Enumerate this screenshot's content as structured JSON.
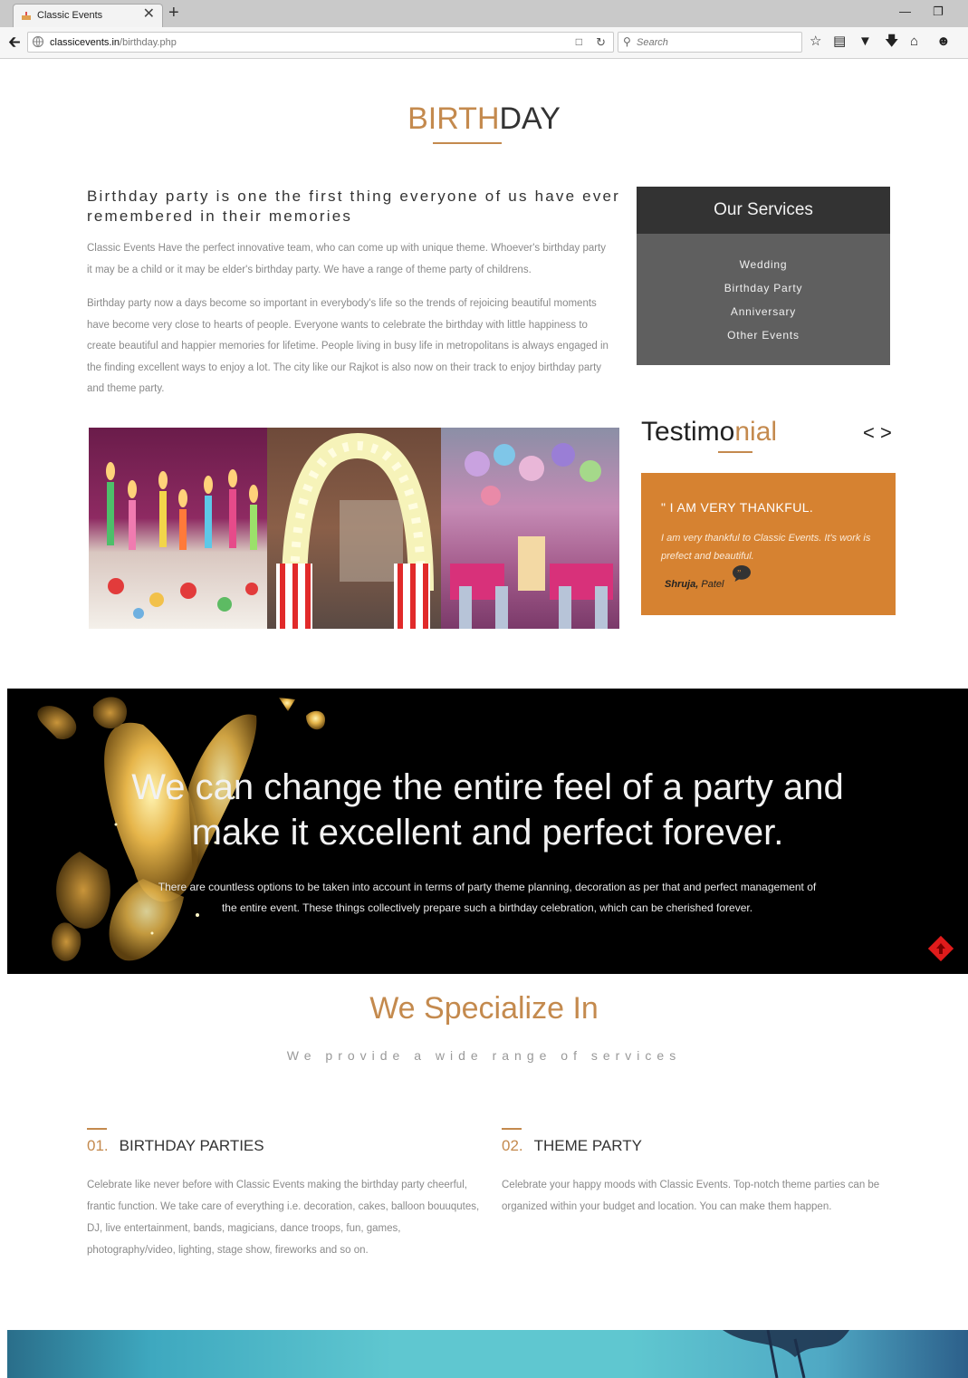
{
  "browser": {
    "tab_title": "Classic Events",
    "tab_close": "✕",
    "new_tab": "+",
    "url_domain": "classicevents.in",
    "url_path": "/birthday.php",
    "search_placeholder": "Search"
  },
  "page": {
    "title_part1": "BIRTH",
    "title_part2": "DAY",
    "intro_heading": "Birthday party is one the first thing everyone of us have ever remembered in their memories",
    "intro_p1": "Classic Events Have the perfect innovative team, who can come up with unique theme. Whoever's birthday party it may be a child or it may be elder's birthday party. We have a range of theme party of childrens.",
    "intro_p2": "Birthday party now a days become so important in everybody's life so the trends of rejoicing beautiful moments have become very close to hearts of people. Everyone wants to celebrate the birthday with little happiness to create beautiful and happier memories for lifetime. People living in busy life in metropolitans is always engaged in the finding excellent ways to enjoy a lot. The city like our Rajkot is also now on their track to enjoy birthday party and theme party."
  },
  "services": {
    "heading": "Our Services",
    "items": [
      "Wedding",
      "Birthday Party",
      "Anniversary",
      "Other Events"
    ]
  },
  "testimonial": {
    "title_part1": "Testimo",
    "title_part2": "nial",
    "prev": "<",
    "next": ">",
    "quote_heading": "\" I AM VERY THANKFUL.",
    "quote": "I am very thankful to Classic Events. It's work is prefect and beautiful.",
    "author_first": "Shruja,",
    "author_last": "Patel"
  },
  "banner": {
    "heading_line1": "We can change the entire feel of a party and",
    "heading_line2": "make it excellent and perfect forever.",
    "text": "There are countless options to be taken into account in terms of party theme planning, decoration as per that and perfect management of the entire event. These things collectively prepare such a birthday celebration, which can be cherished forever."
  },
  "specialize": {
    "heading": "We Specialize In",
    "subheading": "We provide a wide range of services",
    "items": [
      {
        "num": "01.",
        "title": "BIRTHDAY PARTIES",
        "text": "Celebrate like never before with Classic Events making the birthday party cheerful, frantic function. We take care of everything i.e. decoration, cakes, balloon bouuqutes, DJ, live entertainment, bands, magicians, dance troops, fun, games, photography/video, lighting, stage show, fireworks and so on."
      },
      {
        "num": "02.",
        "title": "THEME PARTY",
        "text": "Celebrate your happy moods with Classic Events. Top-notch theme parties can be organized within your budget and location. You can make them happen."
      }
    ]
  },
  "colors": {
    "accent": "#c48a4e",
    "testimonial_bg": "#d68231",
    "services_head": "#333333",
    "services_body": "#5f5f5f"
  }
}
